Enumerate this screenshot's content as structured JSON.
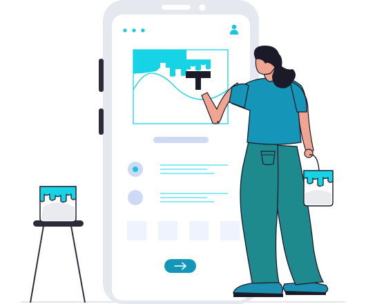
{
  "illustration": {
    "phone": {
      "status_dots": 3,
      "list_rows": 2,
      "thumbnails": 4,
      "next_button_icon": "arrow-right-icon",
      "profile_icon": "user-icon"
    },
    "palette": {
      "accent": "#17d3e6",
      "teal_shirt": "#1496b8",
      "pants": "#1f8a8d",
      "outline": "#2b2b3a",
      "phone_frame": "#e4e6ee",
      "placeholder": "#cdd9f5"
    },
    "paint_drip_icon": "paint-drip-icon",
    "brush_icon": "paint-brush-icon",
    "bucket_icon": "paint-bucket-icon"
  }
}
